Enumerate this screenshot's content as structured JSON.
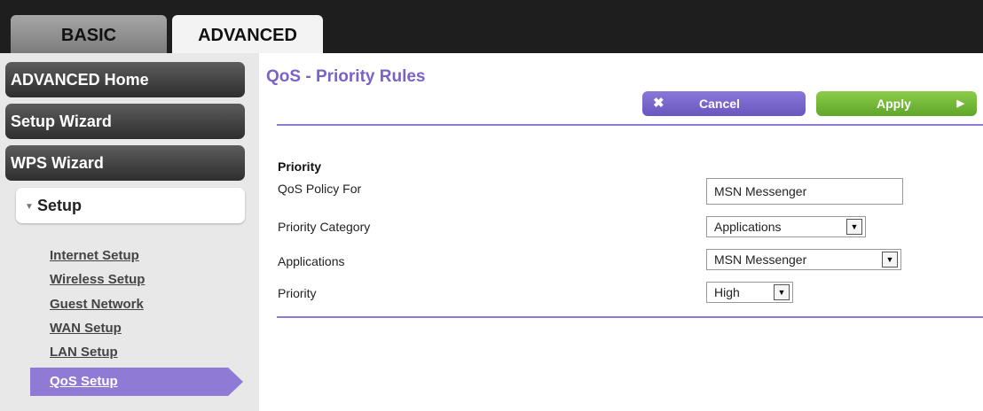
{
  "tabs": {
    "basic": "BASIC",
    "advanced": "ADVANCED"
  },
  "sidebar": {
    "advanced_home": "ADVANCED Home",
    "setup_wizard": "Setup Wizard",
    "wps_wizard": "WPS Wizard",
    "setup": "Setup",
    "sub_items": [
      "Internet Setup",
      "Wireless Setup",
      "Guest Network",
      "WAN Setup",
      "LAN Setup",
      "QoS Setup"
    ]
  },
  "page": {
    "title": "QoS - Priority Rules",
    "cancel_label": "Cancel",
    "apply_label": "Apply",
    "section_heading": "Priority"
  },
  "form": {
    "policy_label": "QoS Policy For",
    "policy_value": "MSN Messenger",
    "category_label": "Priority Category",
    "category_value": "Applications",
    "applications_label": "Applications",
    "applications_value": "MSN Messenger",
    "priority_label": "Priority",
    "priority_value": "High"
  },
  "colors": {
    "accent": "#8f7ad6",
    "apply": "#6cb52f",
    "topbar": "#1e1e1e"
  }
}
